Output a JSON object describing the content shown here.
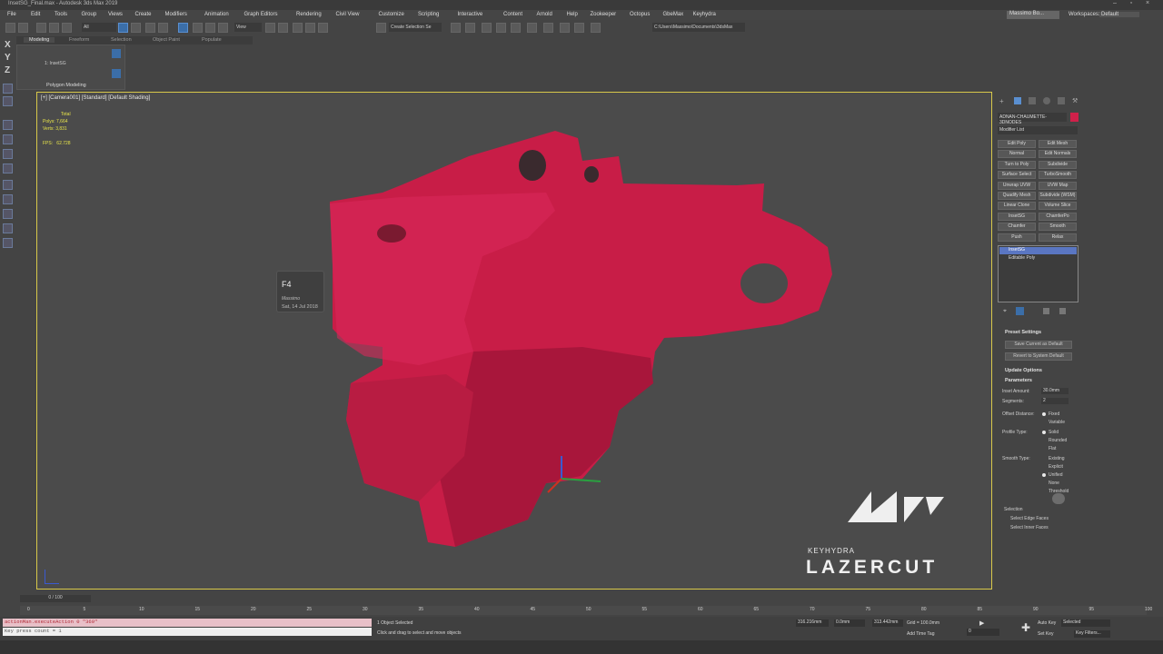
{
  "window": {
    "title": "InsetSG_Final.max - Autodesk 3ds Max 2019",
    "user": "Massimo Bo...",
    "workspaces_label": "Workspaces:",
    "workspace": "Default"
  },
  "menu": [
    "File",
    "Edit",
    "Tools",
    "Group",
    "Views",
    "Create",
    "Modifiers",
    "Animation",
    "Graph Editors",
    "Rendering",
    "Civil View",
    "Customize",
    "Scripting",
    "Interactive",
    "Content",
    "Arnold",
    "Help",
    "Zookeeper",
    "Octopus",
    "GbeMax",
    "Keyhydra"
  ],
  "toolbar": {
    "filter": "All",
    "view": "View",
    "selection_set": "Create Selection Se",
    "path": "C:\\Users\\Massimo\\Documents\\3dsMax"
  },
  "ribbon": {
    "tabs": [
      "Modeling",
      "Freeform",
      "Selection",
      "Object Paint",
      "Populate"
    ],
    "label": "Polygon Modeling",
    "sublabel": "1: InsetSG"
  },
  "axes": [
    "X",
    "Y",
    "Z"
  ],
  "viewport": {
    "label": "[+] [Camera001] [Standard] [Default Shading]",
    "stats": {
      "total": "Total",
      "polys_label": "Polys:",
      "polys": "7,664",
      "verts_label": "Verts:",
      "verts": "3,831",
      "fps_label": "FPS:",
      "fps": "62.728"
    },
    "bubble": {
      "key": "F4",
      "name": "Massimo",
      "date": "Sat, 14 Jul 2018"
    },
    "brand": "KEYHYDRA",
    "logo": "LAZERCUT",
    "object_color": "#c81d47"
  },
  "command_panel": {
    "object_name": "ADNAN-CHAUMETTE-3DNODES",
    "modifier_list": "Modifier List",
    "modifier_buttons": [
      "Edit Poly",
      "Edit Mesh",
      "Normal",
      "Edit Normals",
      "Turn to Poly",
      "Subdivide",
      "Surface Select",
      "TurboSmooth",
      "Unwrap UVW",
      "UVW Map",
      "Quadify Mesh",
      "Subdivide (WSM)",
      "Linear Clone",
      "Volume Slice",
      "InsetSG",
      "ChamferPo",
      "Chamfer",
      "Smooth",
      "Push",
      "Relax"
    ],
    "stack": [
      "InsetSG",
      "Editable Poly"
    ],
    "preset_settings": "Preset Settings",
    "save_default": "Save Current as Default",
    "revert_default": "Revert to System Default",
    "update_options": "Update Options",
    "parameters": "Parameters",
    "inset_amount_label": "Inset Amount:",
    "inset_amount": "30.0mm",
    "segments_label": "Segments:",
    "segments": "2",
    "offset_distance_label": "Offset Distance:",
    "offset_options": [
      "Fixed",
      "Variable"
    ],
    "profile_type_label": "Profile Type:",
    "profile_options": [
      "Solid",
      "Rounded",
      "Flat"
    ],
    "smooth_type_label": "Smooth Type:",
    "smooth_options": [
      "Existing",
      "Explicit",
      "Unified",
      "None",
      "Threshold"
    ],
    "selection_label": "Selection",
    "select_edge": "Select Edge Faces",
    "select_inner": "Select Inner Faces"
  },
  "timeline": {
    "position": "0 / 100",
    "ticks": [
      "0",
      "5",
      "10",
      "15",
      "20",
      "25",
      "30",
      "35",
      "40",
      "45",
      "50",
      "55",
      "60",
      "65",
      "70",
      "75",
      "80",
      "85",
      "90",
      "95",
      "100"
    ]
  },
  "status": {
    "maxscript1": "actionMan.executeAction 0 \"369\"",
    "maxscript2": "Key press count = 1",
    "selected": "1 Object Selected",
    "hint": "Click and drag to select and move objects",
    "x": "316.216mm",
    "y": "0.0mm",
    "z": "313.442mm",
    "grid": "Grid = 100.0mm",
    "add_time_tag": "Add Time Tag",
    "auto_key": "Auto Key",
    "selected_dd": "Selected",
    "set_key": "Set Key",
    "key_filters": "Key Filters...",
    "frame": "0"
  }
}
